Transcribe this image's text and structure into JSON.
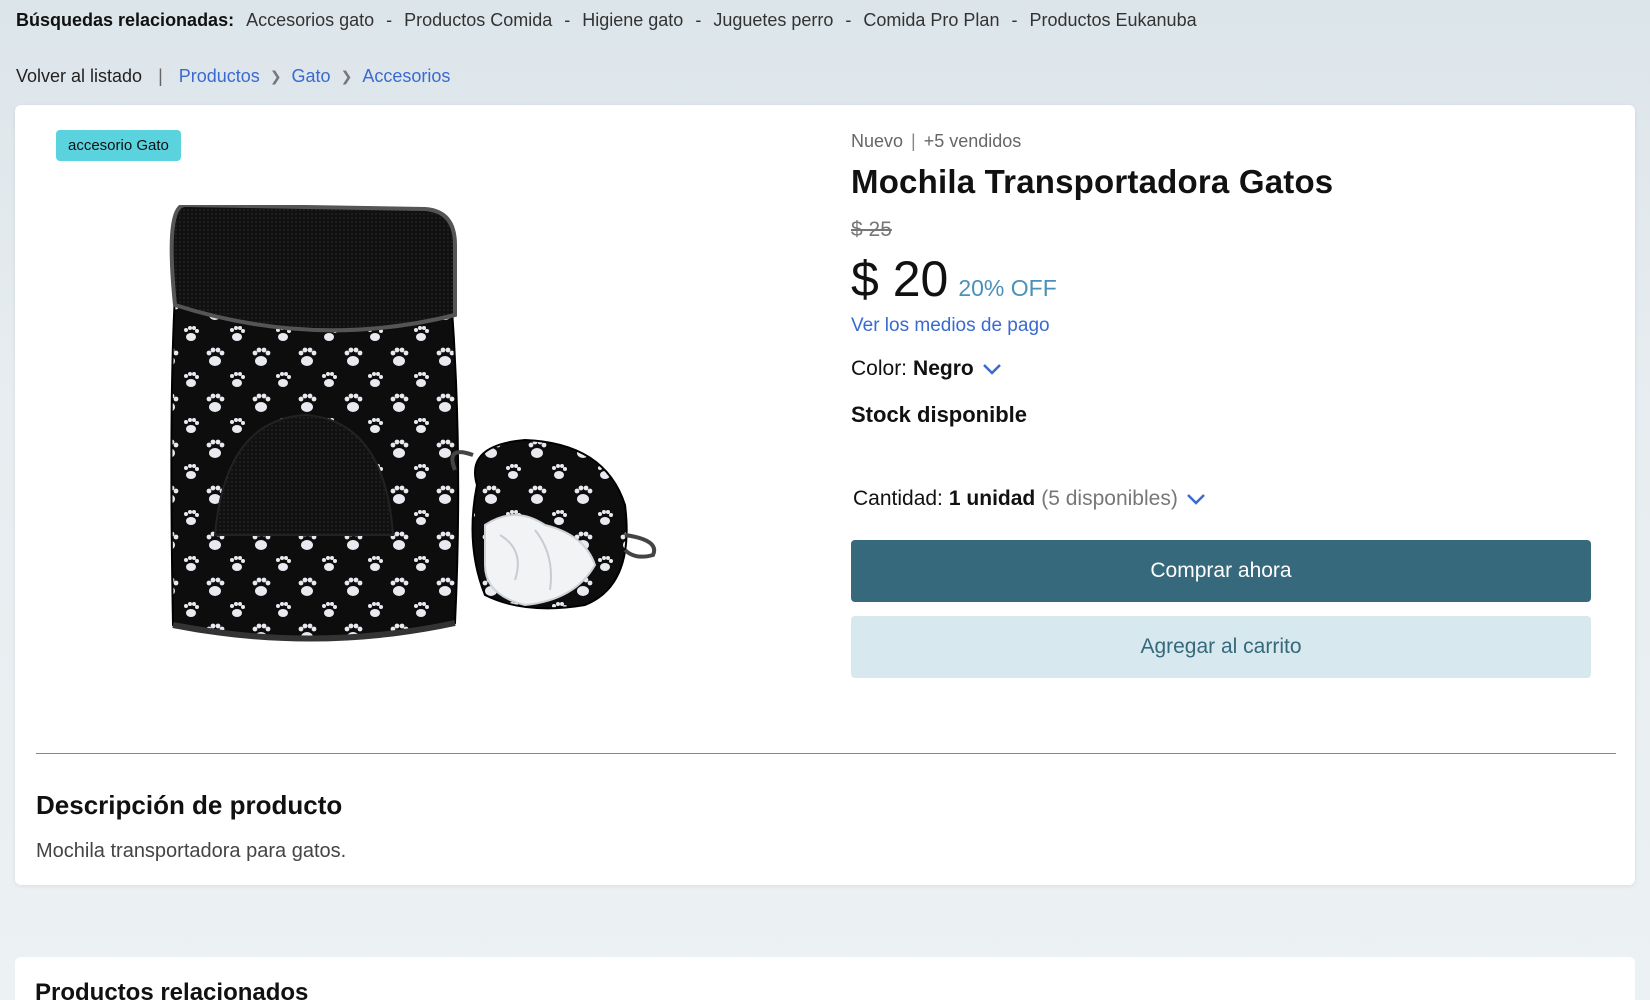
{
  "related_searches": {
    "title": "Búsquedas relacionadas:",
    "items": [
      "Accesorios gato",
      "Productos Comida",
      "Higiene gato",
      "Juguetes perro",
      "Comida Pro Plan",
      "Productos Eukanuba"
    ],
    "separator": "-"
  },
  "breadcrumb": {
    "back": "Volver al listado",
    "pipe": "|",
    "crumbs": [
      "Productos",
      "Gato",
      "Accesorios"
    ]
  },
  "product": {
    "tag": "accesorio Gato",
    "condition": "Nuevo",
    "sold": "+5 vendidos",
    "title": "Mochila Transportadora Gatos",
    "old_price": "$ 25",
    "price": "$ 20",
    "discount": "20% OFF",
    "payment_link": "Ver los medios de pago",
    "color_label": "Color:",
    "color_value": "Negro",
    "stock": "Stock disponible",
    "qty_label": "Cantidad:",
    "qty_value": "1 unidad",
    "qty_available": "(5 disponibles)",
    "buy_label": "Comprar ahora",
    "cart_label": "Agregar al carrito",
    "image_alt": "Mochila Transportadora Gatos"
  },
  "description": {
    "title": "Descripción de producto",
    "text": "Mochila transportadora para gatos."
  },
  "related_products": {
    "title": "Productos relacionados"
  },
  "colors": {
    "accent": "#35697b",
    "accent_light": "#d7e8ee",
    "link": "#3a6ad0",
    "badge": "#5bd3df",
    "discount": "#4a90b8"
  }
}
